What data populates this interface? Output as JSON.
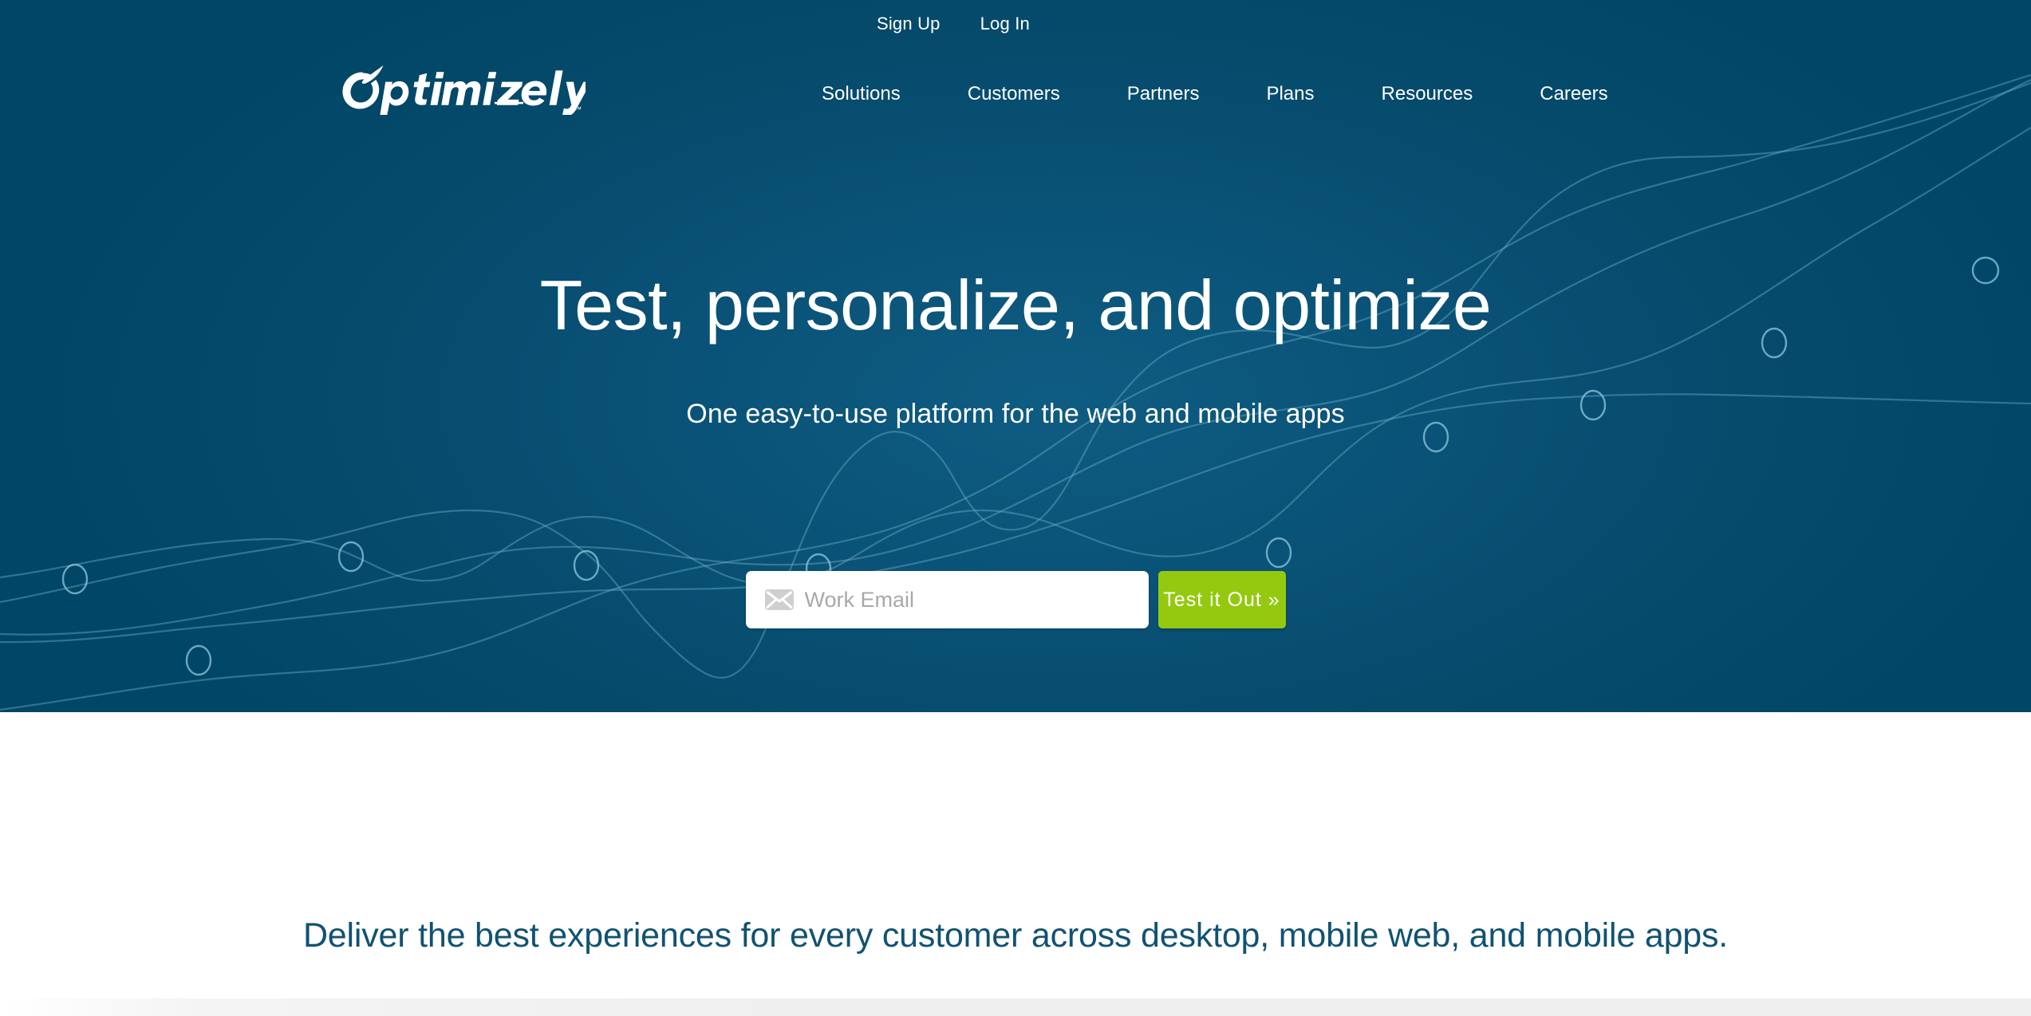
{
  "brand": {
    "name": "Optimizely",
    "trademark": "™",
    "hero_bg": "#004666",
    "hero_bg_center": "#0f5c82",
    "accent_green": "#94c90f",
    "heading_teal": "#115272"
  },
  "utility_nav": {
    "items": [
      {
        "label": "Sign Up",
        "name": "sign-up"
      },
      {
        "label": "Log In",
        "name": "log-in"
      }
    ]
  },
  "main_nav": {
    "items": [
      {
        "label": "Solutions"
      },
      {
        "label": "Customers"
      },
      {
        "label": "Partners"
      },
      {
        "label": "Plans"
      },
      {
        "label": "Resources"
      },
      {
        "label": "Careers"
      }
    ]
  },
  "hero": {
    "title": "Test, personalize, and optimize",
    "subtitle": "One easy-to-use platform for the web and mobile apps",
    "form": {
      "email_value": "",
      "email_placeholder": "Work Email",
      "email_icon": "envelope-icon",
      "cta_label": "Test it Out »"
    }
  },
  "section_white": {
    "heading": "Deliver the best experiences for every customer across desktop, mobile web, and mobile apps."
  }
}
